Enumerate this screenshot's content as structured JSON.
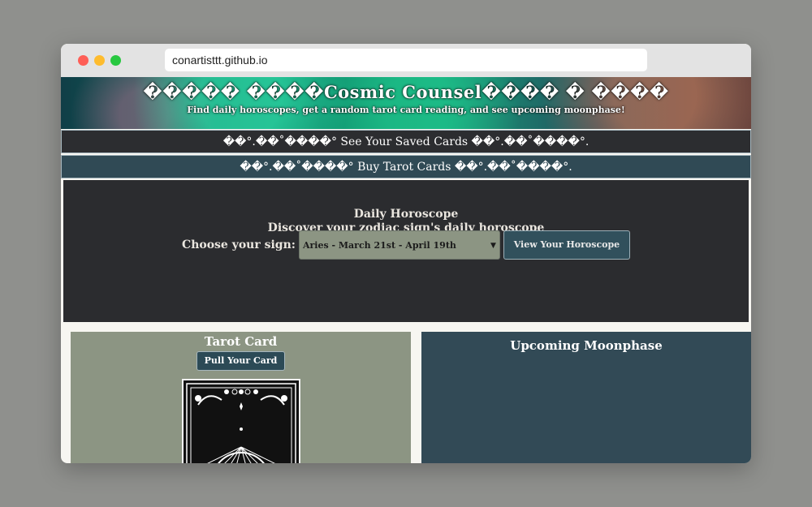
{
  "browser": {
    "url": "conartisttt.github.io"
  },
  "header": {
    "title": "����� ����Cosmic Counsel���� � ����",
    "subtitle": "Find daily horoscopes, get a random tarot card reading, and see upcoming moonphase!"
  },
  "nav": {
    "saved_label": "��°.��˚����° See Your Saved Cards ��°.��˚����°.",
    "buy_label": "��°.��˚����° Buy Tarot Cards ��°.��˚����°."
  },
  "horoscope": {
    "title": "Daily Horoscope",
    "subtitle": "Discover your zodiac sign's daily horoscope",
    "choose_label": "Choose your sign:",
    "selected_option": "Aries - March 21st - April 19th",
    "view_button": "View Your Horoscope"
  },
  "tarot": {
    "title": "Tarot Card",
    "button": "Pull Your Card"
  },
  "moonphase": {
    "title": "Upcoming Moonphase"
  },
  "icons": [
    "chevron-down-icon"
  ]
}
